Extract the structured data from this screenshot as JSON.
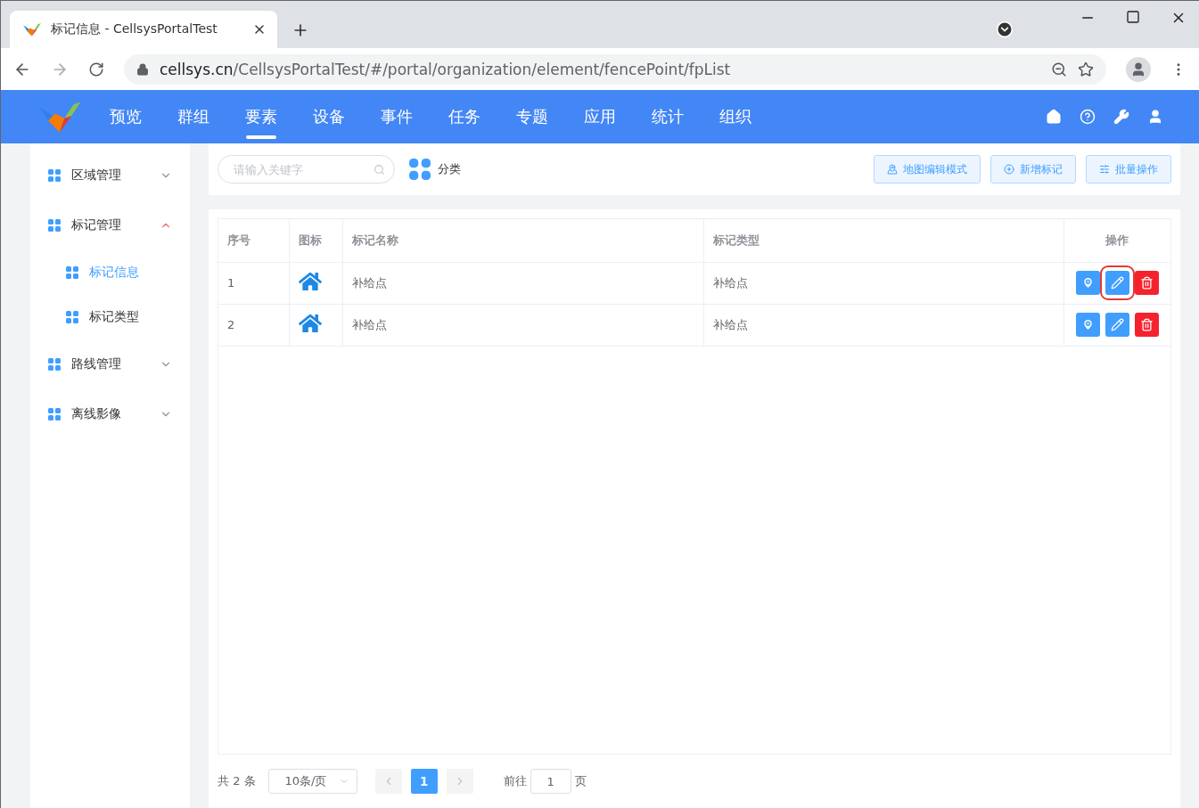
{
  "browser": {
    "tab_title": "标记信息 - CellsysPortalTest",
    "url_host": "cellsys.cn",
    "url_path": "/CellsysPortalTest/#/portal/organization/element/fencePoint/fpList"
  },
  "nav": {
    "items": [
      {
        "label": "预览",
        "selected": false
      },
      {
        "label": "群组",
        "selected": false
      },
      {
        "label": "要素",
        "selected": true
      },
      {
        "label": "设备",
        "selected": false
      },
      {
        "label": "事件",
        "selected": false
      },
      {
        "label": "任务",
        "selected": false
      },
      {
        "label": "专题",
        "selected": false
      },
      {
        "label": "应用",
        "selected": false
      },
      {
        "label": "统计",
        "selected": false
      },
      {
        "label": "组织",
        "selected": false
      }
    ]
  },
  "sidebar": {
    "items": [
      {
        "label": "区域管理",
        "expanded": false
      },
      {
        "label": "标记管理",
        "expanded": true,
        "children": [
          {
            "label": "标记信息",
            "selected": true
          },
          {
            "label": "标记类型",
            "selected": false
          }
        ]
      },
      {
        "label": "路线管理",
        "expanded": false
      },
      {
        "label": "离线影像",
        "expanded": false
      }
    ]
  },
  "toolbar": {
    "search": {
      "placeholder": "请输入关键字"
    },
    "category": "分类",
    "buttons": [
      {
        "kind": "map",
        "label": "地图编辑模式"
      },
      {
        "kind": "add",
        "label": "新增标记"
      },
      {
        "kind": "batch",
        "label": "批量操作"
      }
    ]
  },
  "table": {
    "columns": [
      "序号",
      "图标",
      "标记名称",
      "标记类型",
      "操作"
    ],
    "rows": [
      {
        "index": "1",
        "name": "补给点",
        "type": "补给点",
        "actions": [
          {
            "kind": "locate",
            "highlighted": false
          },
          {
            "kind": "edit",
            "highlighted": true
          },
          {
            "kind": "delete",
            "highlighted": false
          }
        ]
      },
      {
        "index": "2",
        "name": "补给点",
        "type": "补给点",
        "actions": [
          {
            "kind": "locate",
            "highlighted": false
          },
          {
            "kind": "edit",
            "highlighted": false
          },
          {
            "kind": "delete",
            "highlighted": false
          }
        ]
      }
    ]
  },
  "pagination": {
    "total": "共 2 条",
    "page_size": "10条/页",
    "pages": [
      {
        "label": "1",
        "selected": true
      }
    ],
    "goto_label": "前往",
    "goto_value": "1",
    "page_suffix": "页"
  }
}
